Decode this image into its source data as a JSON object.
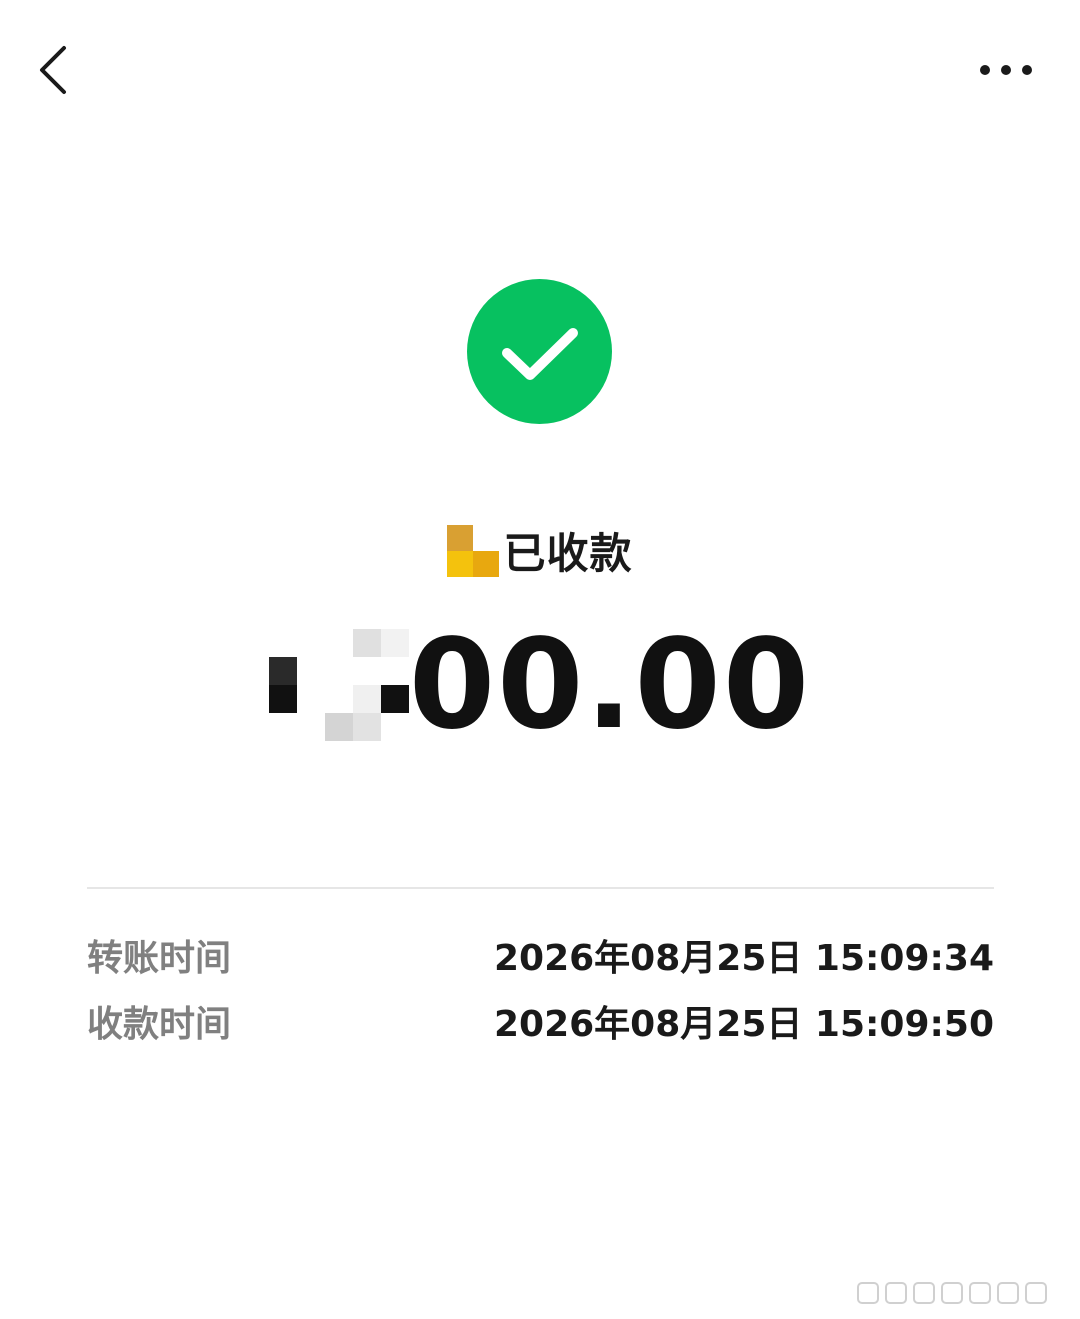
{
  "header": {
    "back_icon": "chevron-left-icon",
    "more_icon": "more-dots-icon"
  },
  "status": {
    "icon": "check-circle-icon",
    "icon_color": "#07C160",
    "text": "已收款"
  },
  "amount": {
    "visible_text": "00.00",
    "obscured": true
  },
  "details": [
    {
      "label": "转账时间",
      "value": "2026年08月25日 15:09:34"
    },
    {
      "label": "收款时间",
      "value": "2026年08月25日 15:09:50"
    }
  ],
  "colors": {
    "accent": "#07C160",
    "label": "#808080",
    "value": "#1a1a1a",
    "divider": "#e6e6e6"
  }
}
